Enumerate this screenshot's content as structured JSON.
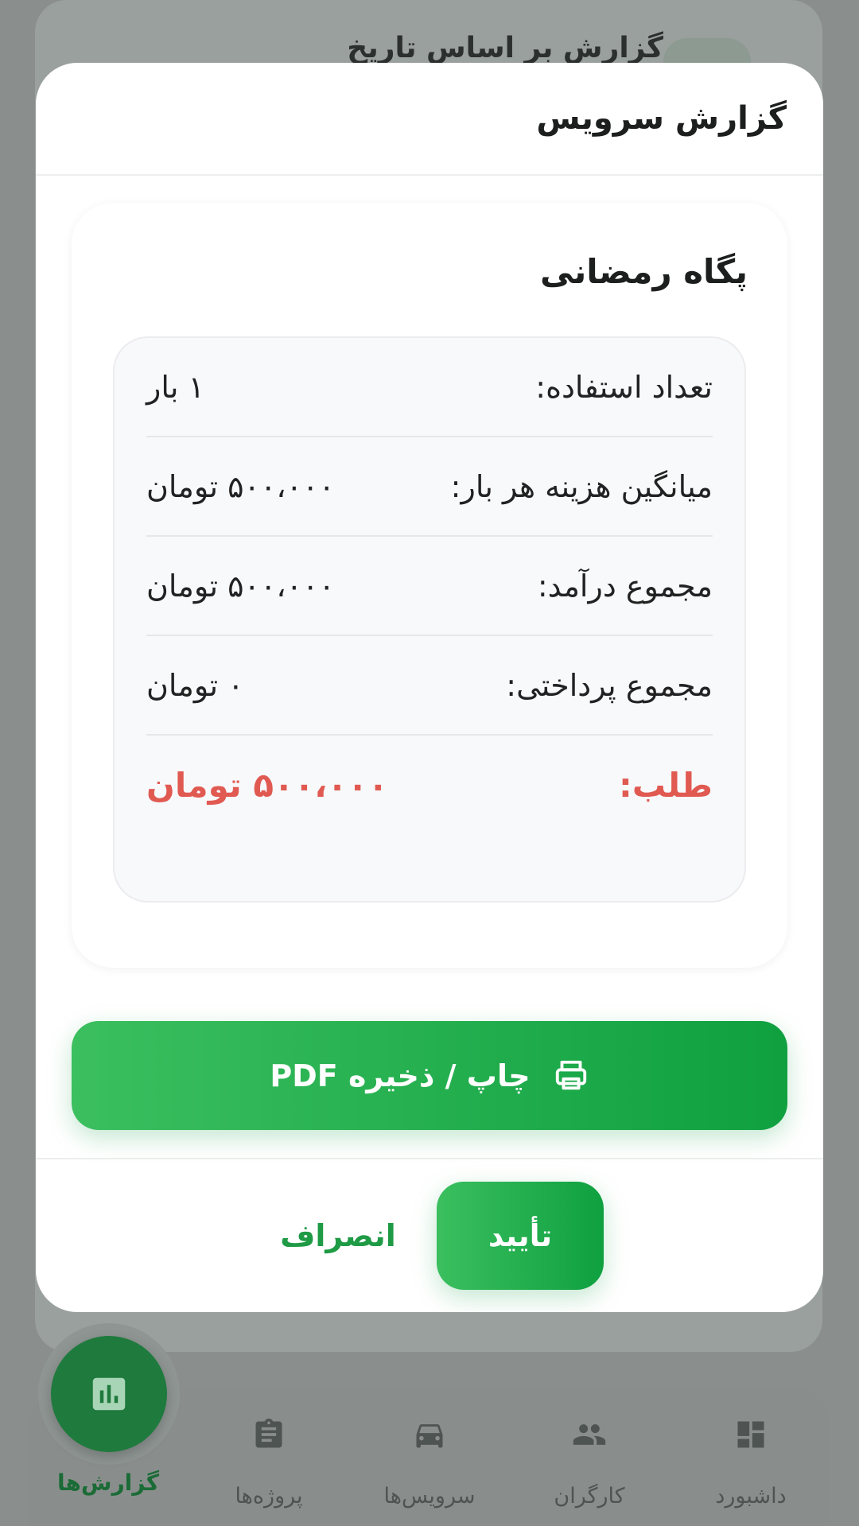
{
  "background": {
    "title": "گزارش بر اساس تاریخ"
  },
  "modal": {
    "title": "گزارش سرویس",
    "report": {
      "name": "پگاه رمضانی",
      "rows": [
        {
          "label": "تعداد استفاده:",
          "value": "۱ بار"
        },
        {
          "label": "میانگین هزینه هر بار:",
          "value": "۵۰۰،۰۰۰ تومان"
        },
        {
          "label": "مجموع درآمد:",
          "value": "۵۰۰،۰۰۰ تومان"
        },
        {
          "label": "مجموع پرداختی:",
          "value": "۰ تومان"
        }
      ],
      "balance": {
        "label": "طلب:",
        "value": "۵۰۰،۰۰۰ تومان",
        "color": "#e05a52"
      }
    },
    "print_label": "چاپ / ذخیره PDF",
    "confirm_label": "تأیید",
    "cancel_label": "انصراف",
    "accent": "#16a34a"
  },
  "nav": {
    "items": [
      {
        "label": "داشبورد",
        "icon": "dashboard-icon"
      },
      {
        "label": "کارگران",
        "icon": "people-icon"
      },
      {
        "label": "سرویس‌ها",
        "icon": "car-icon"
      },
      {
        "label": "پروژه‌ها",
        "icon": "clipboard-icon"
      },
      {
        "label": "گزارش‌ها",
        "icon": "bar-chart-icon",
        "active": true
      }
    ]
  }
}
